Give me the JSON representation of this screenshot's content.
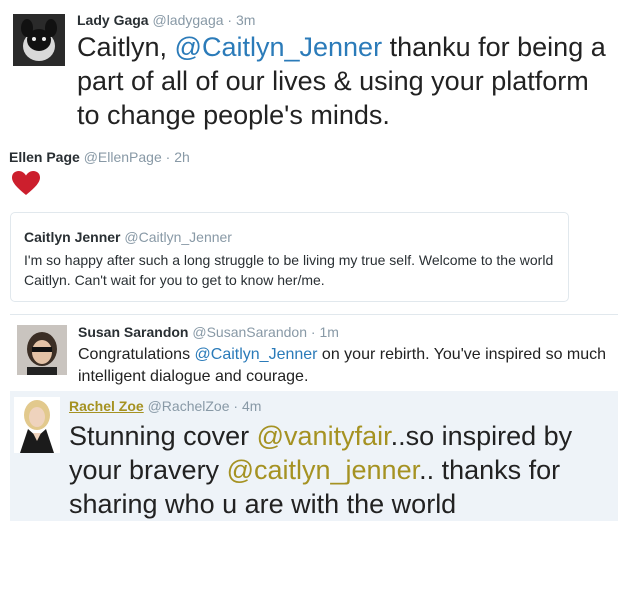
{
  "tweets": {
    "gaga": {
      "name": "Lady Gaga",
      "handle": "@ladygaga",
      "sep": "·",
      "time": "3m",
      "text_pre": "Caitlyn, ",
      "mention": "@Caitlyn_Jenner",
      "text_post": " thanku for being a part of all of our lives & using your platform to change people's minds."
    },
    "ellen": {
      "name": "Ellen Page",
      "handle": "@EllenPage",
      "sep": "·",
      "time": "2h",
      "quote": {
        "name": "Caitlyn Jenner",
        "handle": "@Caitlyn_Jenner",
        "text": "I'm so happy after such a long struggle to be living my true self. Welcome to the world Caitlyn. Can't wait for you to get to know her/me."
      }
    },
    "susan": {
      "name": "Susan Sarandon",
      "handle": "@SusanSarandon",
      "sep": "·",
      "time": "1m",
      "text_pre": "Congratulations ",
      "mention": "@Caitlyn_Jenner",
      "text_post": " on your rebirth. You've inspired so much intelligent dialogue and courage."
    },
    "rachel": {
      "name": "Rachel Zoe",
      "handle": "@RachelZoe",
      "sep": "·",
      "time": "4m",
      "text_pre": "Stunning cover ",
      "mention1": "@vanityfair",
      "text_mid": "..so inspired by your bravery ",
      "mention2": "@caitlyn_jenner",
      "text_post": ".. thanks for sharing who u are with the world"
    }
  },
  "icons": {
    "heart": "heart-icon"
  },
  "colors": {
    "mention": "#2b7bb9",
    "mention_gold": "#a59222",
    "heart": "#cc1f2d",
    "highlight_bg": "#eef3f8"
  }
}
